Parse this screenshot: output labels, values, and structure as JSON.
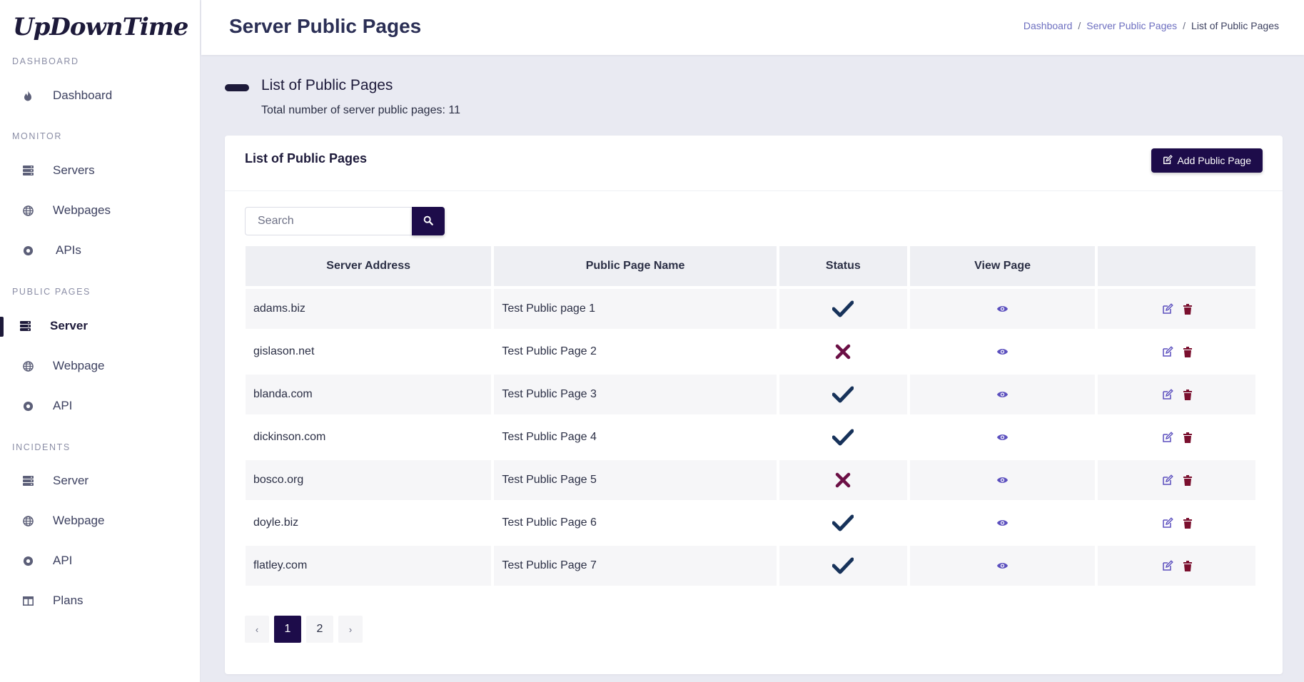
{
  "app": {
    "logo": "UpDownTime"
  },
  "sidebar": {
    "sections": [
      {
        "label": "DASHBOARD"
      },
      {
        "label": "MONITOR"
      },
      {
        "label": "PUBLIC PAGES"
      },
      {
        "label": "INCIDENTS"
      }
    ],
    "items": [
      {
        "label": "Dashboard",
        "icon": "fire-icon"
      },
      {
        "label": "Servers",
        "icon": "server-icon"
      },
      {
        "label": "Webpages",
        "icon": "globe-icon"
      },
      {
        "label": "APIs",
        "icon": "record-icon"
      },
      {
        "label": "Server",
        "icon": "server-icon",
        "active": true
      },
      {
        "label": "Webpage",
        "icon": "globe-icon"
      },
      {
        "label": "API",
        "icon": "record-icon"
      },
      {
        "label": "Server",
        "icon": "server-icon"
      },
      {
        "label": "Webpage",
        "icon": "globe-icon"
      },
      {
        "label": "API",
        "icon": "record-icon"
      },
      {
        "label": "Plans",
        "icon": "table-icon"
      }
    ]
  },
  "header": {
    "title": "Server Public Pages",
    "breadcrumb": [
      "Dashboard",
      "Server Public Pages",
      "List of Public Pages"
    ]
  },
  "content": {
    "title": "List of Public Pages",
    "subtitle": "Total number of server public pages: 11"
  },
  "card": {
    "title": "List of Public Pages",
    "add_button": "Add Public Page",
    "search_placeholder": "Search"
  },
  "table": {
    "columns": [
      "Server Address",
      "Public Page Name",
      "Status",
      "View Page",
      ""
    ],
    "rows": [
      {
        "address": "adams.biz",
        "name": "Test Public page 1",
        "status": "active"
      },
      {
        "address": "gislason.net",
        "name": "Test Public Page 2",
        "status": "inactive"
      },
      {
        "address": "blanda.com",
        "name": "Test Public Page 3",
        "status": "active"
      },
      {
        "address": "dickinson.com",
        "name": "Test Public Page 4",
        "status": "active"
      },
      {
        "address": "bosco.org",
        "name": "Test Public Page 5",
        "status": "inactive"
      },
      {
        "address": "doyle.biz",
        "name": "Test Public Page 6",
        "status": "active"
      },
      {
        "address": "flatley.com",
        "name": "Test Public Page 7",
        "status": "active"
      }
    ]
  },
  "pagination": {
    "prev": "‹",
    "next": "›",
    "pages": [
      "1",
      "2"
    ],
    "current": "1"
  },
  "colors": {
    "primary": "#1d0c4a",
    "check": "#17325a",
    "cross": "#6b0f45",
    "eye": "#5b4fbe",
    "trash": "#7a0f2e"
  }
}
